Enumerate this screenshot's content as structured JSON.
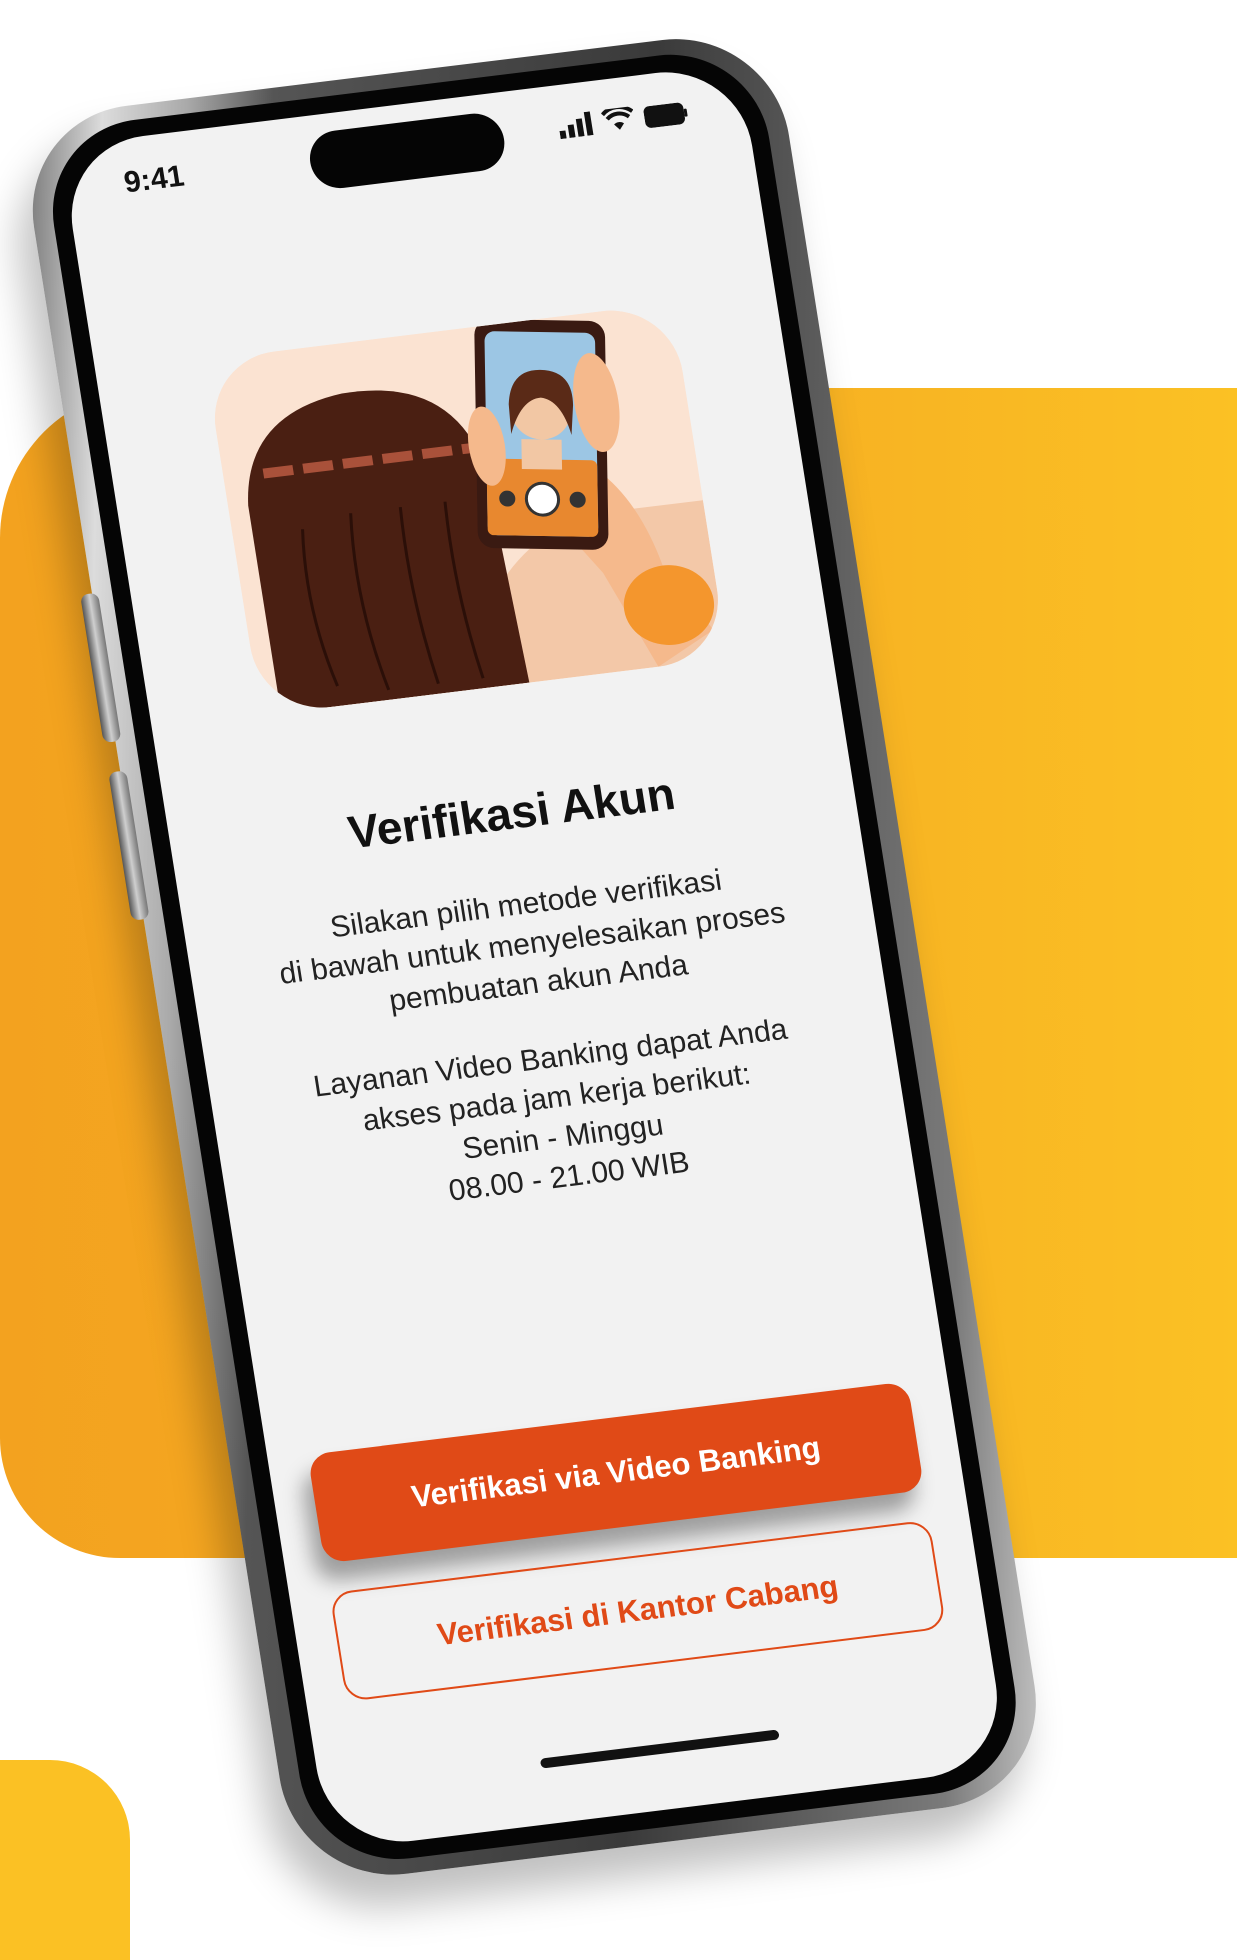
{
  "status_bar": {
    "time": "9:41"
  },
  "screen": {
    "title": "Verifikasi Akun",
    "description": "Silakan pilih metode verifikasi\ndi bawah untuk menyelesaikan proses\npembuatan akun Anda",
    "hours_info": "Layanan Video Banking dapat Anda\nakses pada jam kerja berikut:\nSenin - Minggu\n08.00 - 21.00 WIB",
    "primary_button": "Verifikasi via Video Banking",
    "secondary_button": "Verifikasi di Kantor Cabang"
  },
  "colors": {
    "accent": "#e04a17",
    "background_blob": "#f6ad22",
    "screen_bg": "#f2f2f2"
  },
  "icons": [
    "signal-icon",
    "wifi-icon",
    "battery-icon"
  ]
}
